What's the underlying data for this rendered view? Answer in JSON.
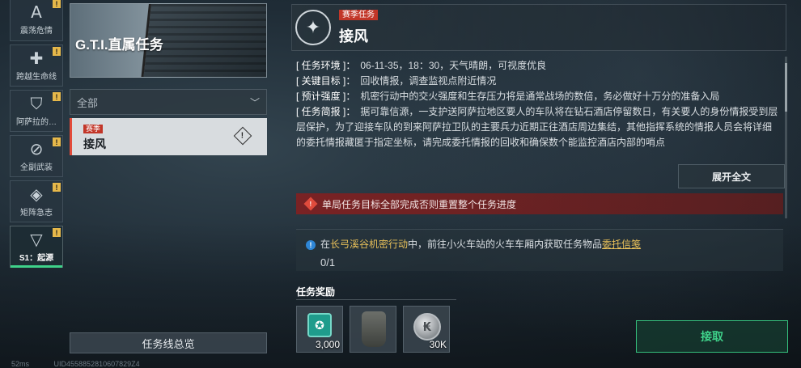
{
  "nav": {
    "items": [
      {
        "label": "震荡危情",
        "icon": "A",
        "badge": "!"
      },
      {
        "label": "跨越生命线",
        "icon": "✚",
        "badge": "!"
      },
      {
        "label": "阿萨拉的…",
        "icon": "⛉",
        "badge": "!"
      },
      {
        "label": "全副武装",
        "icon": "⊘",
        "badge": "!"
      },
      {
        "label": "矩阵急志",
        "icon": "◈",
        "badge": "!"
      },
      {
        "label": "S1：起源",
        "icon": "▽",
        "badge": "!"
      }
    ]
  },
  "sidebar": {
    "banner_title": "G.T.I.直属任务",
    "filter_label": "全部",
    "mission": {
      "tag": "赛季",
      "name": "接风",
      "warn_icon": "!"
    },
    "overview_button": "任务线总览"
  },
  "status": {
    "ping": "52ms",
    "uid": "UID4558852810607829Z4"
  },
  "header": {
    "tag": "赛季任务",
    "title": "接风",
    "emblem_icon": "✦"
  },
  "details": [
    {
      "key": "[ 任务环境 ]：",
      "value": "06-11-35，18：30，天气晴朗，可视度优良"
    },
    {
      "key": "[ 关键目标 ]：",
      "value": "回收情报，调查监视点附近情况"
    },
    {
      "key": "[ 预计强度 ]：",
      "value": "机密行动中的交火强度和生存压力将是通常战场的数倍，务必做好十万分的准备入局"
    },
    {
      "key": "[ 任务简报 ]：",
      "value": "据可靠信源，一支护送阿萨拉地区要人的车队将在钻石酒店停留数日，有关要人的身份情报受到层层保护，为了迎接车队的到来阿萨拉卫队的主要兵力近期正往酒店周边集结，其他指挥系统的情报人员会将详细的委托情报藏匿于指定坐标，请完成委托情报的回收和确保数个能监控酒店内部的哨点"
    }
  ],
  "expand_button": "展开全文",
  "warning": {
    "icon": "!",
    "text": "单局任务目标全部完成否则重置整个任务进度"
  },
  "objective": {
    "info_icon": "!",
    "prefix": "在",
    "location": "长弓溪谷机密行动",
    "middle": "中，前往小火车站的火车车厢内获取任务物品",
    "item": "委托信笺",
    "progress": "0/1"
  },
  "rewards": {
    "title": "任务奖励",
    "items": [
      {
        "icon": "xp-badge-icon",
        "value": "3,000"
      },
      {
        "icon": "body-armor-icon",
        "value": ""
      },
      {
        "icon": "silver-coin-icon",
        "value": "30K"
      }
    ]
  },
  "accept_button": "接取",
  "colors": {
    "accent": "#3fd28a",
    "danger": "#c23628",
    "highlight": "#e8c05a"
  }
}
